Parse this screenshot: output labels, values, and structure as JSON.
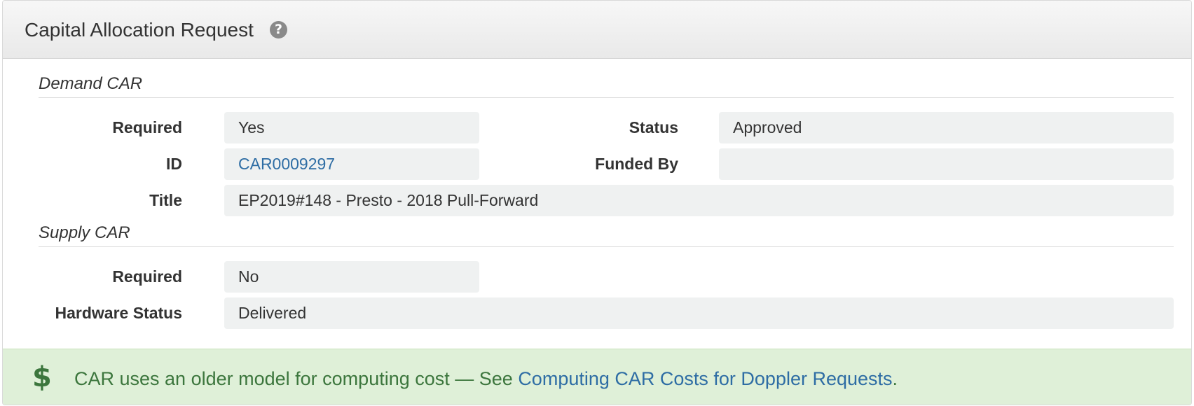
{
  "panel": {
    "title": "Capital Allocation Request",
    "help_icon": "question-circle-icon"
  },
  "demand": {
    "heading": "Demand CAR",
    "required_label": "Required",
    "required_value": "Yes",
    "status_label": "Status",
    "status_value": "Approved",
    "id_label": "ID",
    "id_value": "CAR0009297",
    "funded_by_label": "Funded By",
    "funded_by_value": "",
    "title_label": "Title",
    "title_value": "EP2019#148 - Presto - 2018 Pull-Forward"
  },
  "supply": {
    "heading": "Supply CAR",
    "required_label": "Required",
    "required_value": "No",
    "hardware_status_label": "Hardware Status",
    "hardware_status_value": "Delivered"
  },
  "alert": {
    "icon": "dollar-icon",
    "text": "CAR uses an older model for computing cost — See ",
    "link_text": "Computing CAR Costs for Doppler Requests",
    "suffix": "."
  },
  "colors": {
    "link": "#2e6da4",
    "alert_bg": "#dff0d8",
    "alert_text": "#3c763d",
    "field_bg": "#eff1f1"
  }
}
